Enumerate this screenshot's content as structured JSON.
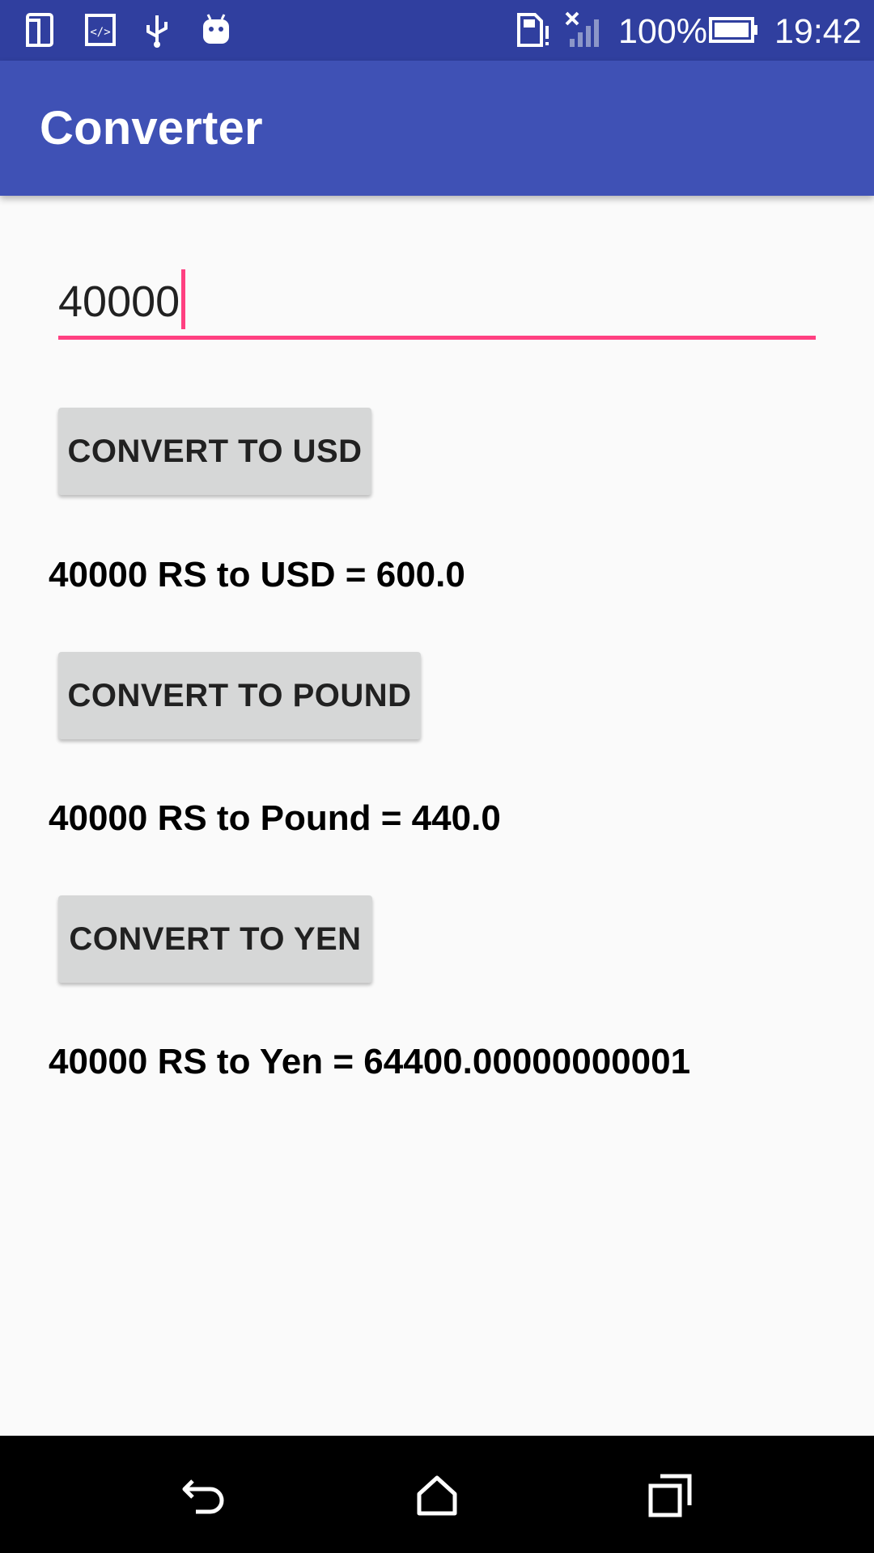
{
  "status_bar": {
    "icons": [
      "tablet-icon",
      "developer-code-icon",
      "usb-icon",
      "android-icon",
      "sim-alert-icon",
      "signal-off-icon",
      "battery-icon"
    ],
    "battery": "100%",
    "time": "19:42"
  },
  "app_bar": {
    "title": "Converter"
  },
  "amount_input": {
    "value": "40000"
  },
  "buttons": {
    "usd": "CONVERT TO USD",
    "pound": "CONVERT TO POUND",
    "yen": "CONVERT TO YEN"
  },
  "results": {
    "usd": "40000 RS to USD = 600.0",
    "pound": "40000 RS to Pound = 440.0",
    "yen": "40000 RS to Yen = 64400.00000000001"
  },
  "nav_bar": {
    "icons": [
      "back-icon",
      "home-icon",
      "recents-icon"
    ]
  },
  "colors": {
    "status_bar": "#303f9f",
    "app_bar": "#3f51b5",
    "accent": "#ff4081",
    "button": "#d6d7d7",
    "background": "#fafafa"
  }
}
